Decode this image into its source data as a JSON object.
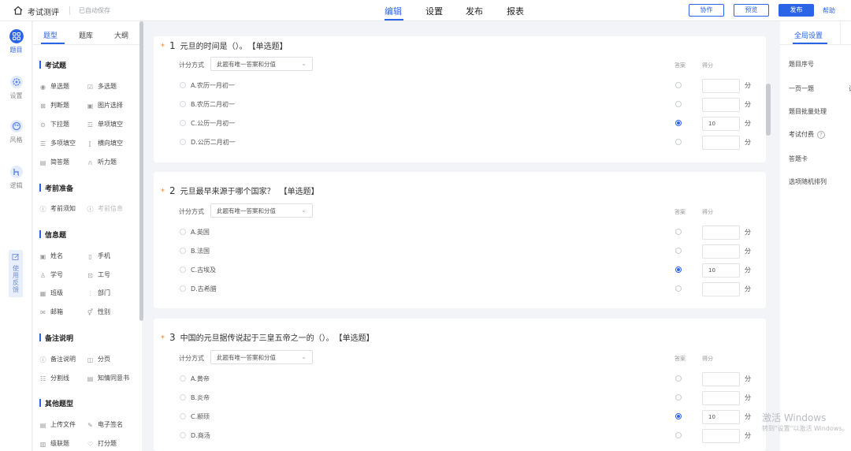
{
  "header": {
    "app_title": "考试测评",
    "autosave": "已自动保存",
    "tabs": [
      "编辑",
      "设置",
      "发布",
      "报表"
    ],
    "active_tab": "编辑",
    "collab_label": "协作",
    "preview_label": "预览",
    "publish_label": "发布",
    "help_label": "帮助",
    "accent": "#2c64e8"
  },
  "rail": {
    "items": [
      {
        "label": "题目",
        "icon": "grid-icon"
      },
      {
        "label": "设置",
        "icon": "gear-icon"
      },
      {
        "label": "风格",
        "icon": "palette-icon"
      },
      {
        "label": "逻辑",
        "icon": "logic-icon"
      }
    ],
    "feedback": "使用反馈"
  },
  "panel": {
    "tabs": [
      "题型",
      "题库",
      "大纲"
    ],
    "groups": [
      {
        "title": "考试题",
        "items": [
          "单选题",
          "多选题",
          "判断题",
          "图片选择",
          "下拉题",
          "单项填空",
          "多项填空",
          "横向填空",
          "简答题",
          "听力题"
        ]
      },
      {
        "title": "考前准备",
        "items": [
          "考前须知",
          "考前信息"
        ]
      },
      {
        "title": "信息题",
        "items": [
          "姓名",
          "手机",
          "学号",
          "工号",
          "班级",
          "部门",
          "邮箱",
          "性别"
        ]
      },
      {
        "title": "备注说明",
        "items": [
          "备注说明",
          "分页",
          "分割线",
          "知情同意书"
        ]
      },
      {
        "title": "其他题型",
        "items": [
          "上传文件",
          "电子签名",
          "级联题",
          "打分题"
        ]
      }
    ]
  },
  "questions": [
    {
      "number": "1",
      "title": "元旦的时间是（）。",
      "type": "【单选题】",
      "score_method_label": "计分方式",
      "score_method_value": "此题有唯一答案和分值",
      "answer_header": "答案",
      "score_header": "得分",
      "options": [
        {
          "label": "A.农历一月初一",
          "correct": false,
          "score": ""
        },
        {
          "label": "B.农历二月初一",
          "correct": false,
          "score": ""
        },
        {
          "label": "C.公历一月初一",
          "correct": true,
          "score": "10"
        },
        {
          "label": "D.公历二月初一",
          "correct": false,
          "score": ""
        }
      ],
      "unit": "分"
    },
    {
      "number": "2",
      "title": "元旦最早来源于哪个国家？",
      "type": "【单选题】",
      "score_method_label": "计分方式",
      "score_method_value": "此题有唯一答案和分值",
      "answer_header": "答案",
      "score_header": "得分",
      "options": [
        {
          "label": "A.英国",
          "correct": false,
          "score": ""
        },
        {
          "label": "B.法国",
          "correct": false,
          "score": ""
        },
        {
          "label": "C.古埃及",
          "correct": true,
          "score": "10"
        },
        {
          "label": "D.古希腊",
          "correct": false,
          "score": ""
        }
      ],
      "unit": "分"
    },
    {
      "number": "3",
      "title": "中国的元旦据传说起于三皇五帝之一的（）。",
      "type": "【单选题】",
      "score_method_label": "计分方式",
      "score_method_value": "此题有唯一答案和分值",
      "answer_header": "答案",
      "score_header": "得分",
      "options": [
        {
          "label": "A.黄帝",
          "correct": false,
          "score": ""
        },
        {
          "label": "B.炎帝",
          "correct": false,
          "score": ""
        },
        {
          "label": "C.颛顼",
          "correct": true,
          "score": "10"
        },
        {
          "label": "D.商汤",
          "correct": false,
          "score": ""
        }
      ],
      "unit": "分"
    }
  ],
  "right_panel": {
    "tab": "全局设置",
    "settings": [
      "题目序号",
      "一页一题",
      "题目批量处理",
      "考试付费",
      "答题卡",
      "选项随机排列"
    ],
    "edge_char": "试"
  },
  "watermark": {
    "line1": "激活 Windows",
    "line2": "转到\"设置\"以激活 Windows。"
  }
}
